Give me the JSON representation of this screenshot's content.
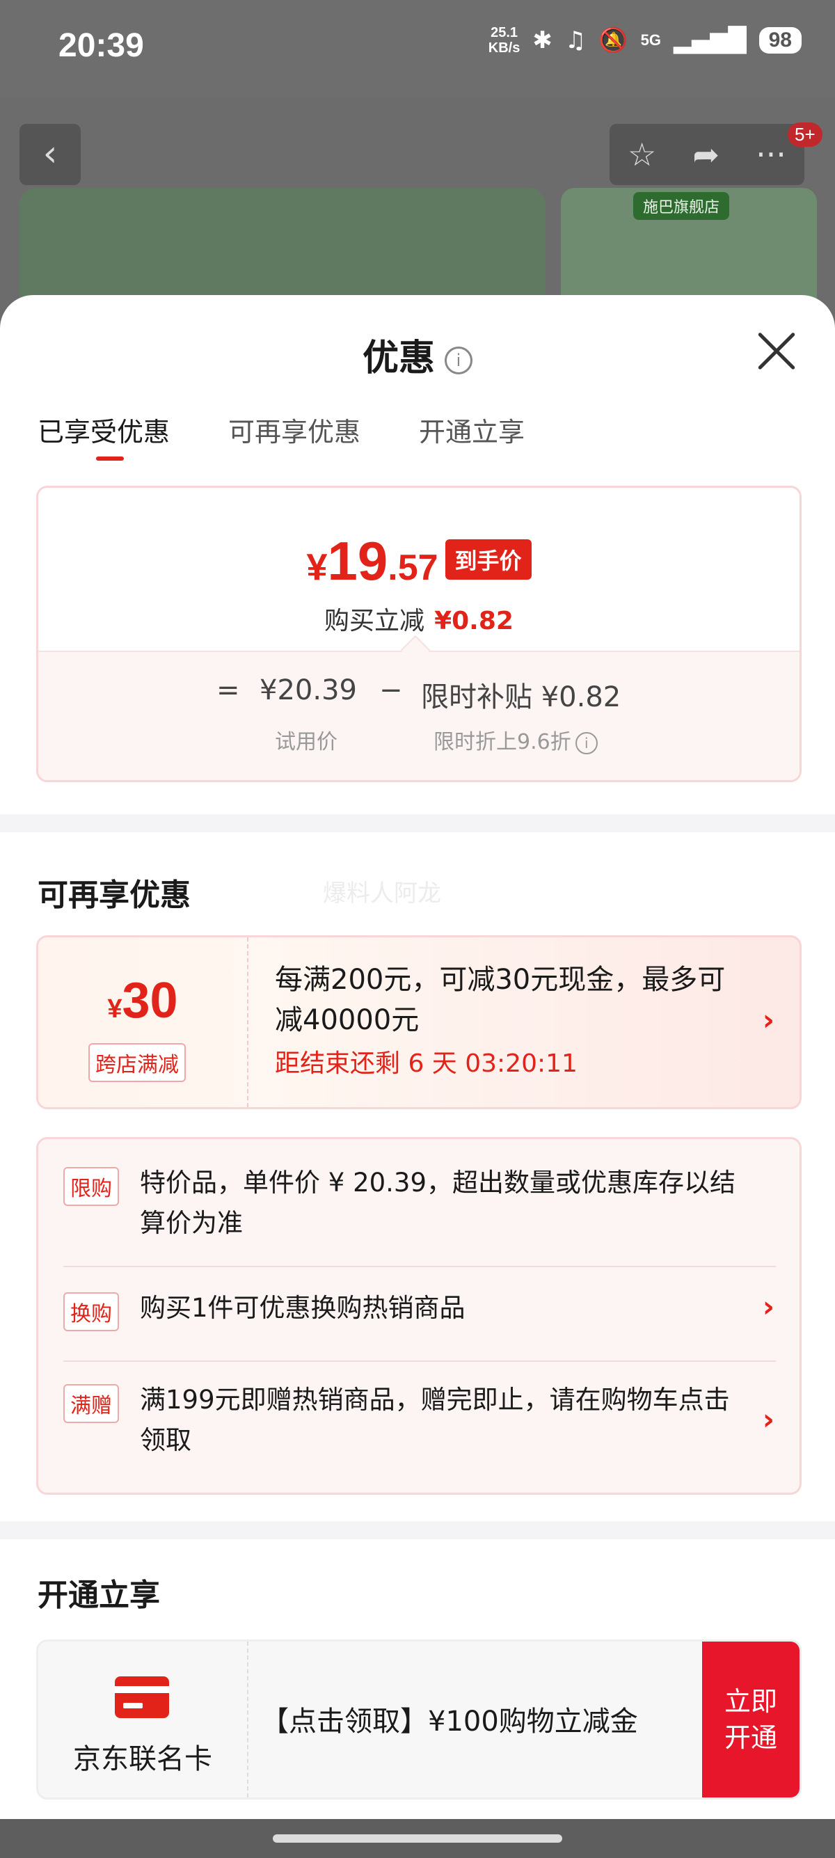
{
  "status_bar": {
    "time": "20:39",
    "net_speed_value": "25.1",
    "net_speed_unit": "KB/s",
    "network": "5G",
    "battery": "98",
    "icons": [
      "bluetooth-icon",
      "earbuds-icon",
      "mute-icon",
      "signal-icon",
      "battery-icon"
    ]
  },
  "background_page": {
    "notification_badge": "5+",
    "shop_tag": "施巴旗舰店"
  },
  "sheet": {
    "title": "优惠",
    "tabs": [
      {
        "label": "已享受优惠",
        "active": true
      },
      {
        "label": "可再享优惠",
        "active": false
      },
      {
        "label": "开通立享",
        "active": false
      }
    ]
  },
  "price_card": {
    "currency": "¥",
    "price_int": "19",
    "price_dec": ".57",
    "price_tag": "到手价",
    "saving_label": "购买立减",
    "saving_value": "¥0.82",
    "equals": "=",
    "trial_price": "¥20.39",
    "minus": "−",
    "subsidy": "限时补贴 ¥0.82",
    "trial_label": "试用价",
    "discount_label": "限时折上9.6折"
  },
  "more_offers": {
    "title": "可再享优惠",
    "watermark": "爆料人阿龙",
    "coupon": {
      "currency": "¥",
      "amount": "30",
      "type_label": "跨店满减",
      "description": "每满200元，可减30元现金，最多可减40000元",
      "countdown": "距结束还剩 6 天 03:20:11"
    },
    "promotions": [
      {
        "tag": "限购",
        "text": "特价品，单件价 ¥ 20.39，超出数量或优惠库存以结算价为准",
        "has_arrow": false
      },
      {
        "tag": "换购",
        "text": "购买1件可优惠换购热销商品",
        "has_arrow": true
      },
      {
        "tag": "满赠",
        "text": "满199元即赠热销商品，赠完即止，请在购物车点击领取",
        "has_arrow": true
      }
    ]
  },
  "open_now": {
    "title": "开通立享",
    "card_name": "京东联名卡",
    "card_desc": "【点击领取】¥100购物立减金",
    "btn_line1": "立即",
    "btn_line2": "开通"
  },
  "colors": {
    "accent": "#e2231a",
    "button": "#e8162b",
    "border_pink": "#f8d6d8"
  }
}
